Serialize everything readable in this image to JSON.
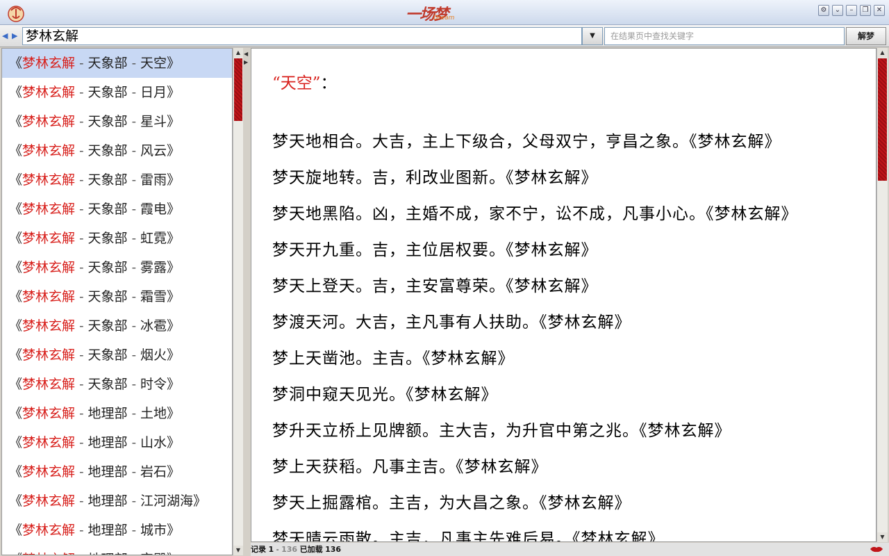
{
  "window": {
    "logo_text": "一场梦",
    "logo_subtitle": "Dream",
    "buttons": [
      "gear",
      "collapse",
      "minimize",
      "maximize",
      "close"
    ]
  },
  "toolbar": {
    "search_value": "梦林玄解",
    "result_search_placeholder": "在结果页中查找关键字",
    "dream_button_label": "解梦"
  },
  "sidebar": {
    "items": [
      {
        "book": "梦林玄解",
        "section": "天象部",
        "topic": "天空",
        "selected": true
      },
      {
        "book": "梦林玄解",
        "section": "天象部",
        "topic": "日月"
      },
      {
        "book": "梦林玄解",
        "section": "天象部",
        "topic": "星斗"
      },
      {
        "book": "梦林玄解",
        "section": "天象部",
        "topic": "风云"
      },
      {
        "book": "梦林玄解",
        "section": "天象部",
        "topic": "雷雨"
      },
      {
        "book": "梦林玄解",
        "section": "天象部",
        "topic": "霞电"
      },
      {
        "book": "梦林玄解",
        "section": "天象部",
        "topic": "虹霓"
      },
      {
        "book": "梦林玄解",
        "section": "天象部",
        "topic": "雾露"
      },
      {
        "book": "梦林玄解",
        "section": "天象部",
        "topic": "霜雪"
      },
      {
        "book": "梦林玄解",
        "section": "天象部",
        "topic": "冰雹"
      },
      {
        "book": "梦林玄解",
        "section": "天象部",
        "topic": "烟火"
      },
      {
        "book": "梦林玄解",
        "section": "天象部",
        "topic": "时令"
      },
      {
        "book": "梦林玄解",
        "section": "地理部",
        "topic": "土地"
      },
      {
        "book": "梦林玄解",
        "section": "地理部",
        "topic": "山水"
      },
      {
        "book": "梦林玄解",
        "section": "地理部",
        "topic": "岩石"
      },
      {
        "book": "梦林玄解",
        "section": "地理部",
        "topic": "江河湖海"
      },
      {
        "book": "梦林玄解",
        "section": "地理部",
        "topic": "城市"
      },
      {
        "book": "梦林玄解",
        "section": "地理部",
        "topic": "宫殿"
      }
    ]
  },
  "content": {
    "title": "天空",
    "entries": [
      "梦天地相合。大吉，主上下级合，父母双宁，亨昌之象。《梦林玄解》",
      "梦天旋地转。吉，利改业图新。《梦林玄解》",
      "梦天地黑陷。凶，主婚不成，家不宁，讼不成，凡事小心。《梦林玄解》",
      "梦天开九重。吉，主位居权要。《梦林玄解》",
      "梦天上登天。吉，主安富尊荣。《梦林玄解》",
      "梦渡天河。大吉，主凡事有人扶助。《梦林玄解》",
      "梦上天凿池。主吉。《梦林玄解》",
      "梦洞中窥天见光。《梦林玄解》",
      "梦升天立桥上见牌额。主大吉，为升官中第之兆。《梦林玄解》",
      "梦上天获稻。凡事主吉。《梦林玄解》",
      "梦天上掘露棺。主吉，为大昌之象。《梦林玄解》",
      "梦天晴云雨散。主吉，凡事主先难后易。《梦林玄解》"
    ]
  },
  "status": {
    "record_label": "记录",
    "record_current": "1",
    "record_total": "136",
    "loaded_label": "已加载",
    "loaded_count": "136"
  },
  "colors": {
    "accent_red": "#d8201c",
    "selection": "#c8d8f4",
    "scroll_thumb": "#c0151a"
  }
}
